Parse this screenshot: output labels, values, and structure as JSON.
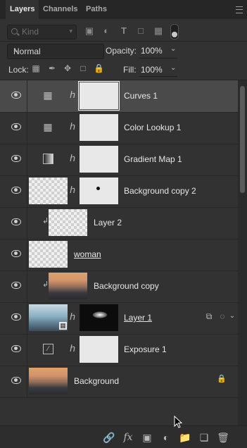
{
  "tabs": [
    {
      "label": "Layers",
      "active": true
    },
    {
      "label": "Channels",
      "active": false
    },
    {
      "label": "Paths",
      "active": false
    }
  ],
  "filter": {
    "placeholder": "Kind",
    "icons": [
      "image-filter-icon",
      "adjustment-filter-icon",
      "type-filter-icon",
      "shape-filter-icon",
      "smart-object-filter-icon"
    ]
  },
  "blend": {
    "mode": "Normal",
    "opacity_label": "Opacity:",
    "opacity_value": "100%"
  },
  "lock": {
    "label": "Lock:",
    "fill_label": "Fill:",
    "fill_value": "100%"
  },
  "layers": [
    {
      "name": "Curves 1",
      "selected": true
    },
    {
      "name": "Color Lookup 1"
    },
    {
      "name": "Gradient Map 1"
    },
    {
      "name": "Background copy 2"
    },
    {
      "name": "Layer 2"
    },
    {
      "name": "woman"
    },
    {
      "name": "Background copy"
    },
    {
      "name": "Layer 1"
    },
    {
      "name": "Exposure 1"
    },
    {
      "name": "Background"
    }
  ],
  "bottom_icons": [
    "link-layers-icon",
    "fx-icon",
    "add-mask-icon",
    "new-adjustment-icon",
    "new-group-icon",
    "new-layer-icon",
    "delete-icon"
  ],
  "fx_label": "fx"
}
